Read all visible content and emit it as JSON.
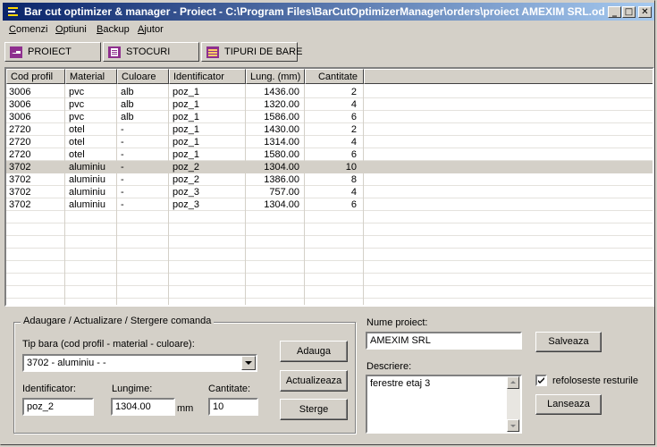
{
  "window": {
    "title": "Bar cut optimizer & manager - Proiect - C:\\Program Files\\BarCutOptimizerManager\\orders\\proiect AMEXIM SRL.odr",
    "minimize_glyph": "_",
    "maximize_glyph": "□",
    "close_glyph": "✕"
  },
  "menu": [
    "Comenzi",
    "Optiuni",
    "Backup",
    "Ajutor"
  ],
  "tabs": [
    {
      "label": "PROIECT",
      "icon": "hand-pointer-icon",
      "color": "#8e2f8e"
    },
    {
      "label": "STOCURI",
      "icon": "document-list-icon",
      "color": "#8e2f8e"
    },
    {
      "label": "TIPURI DE BARE",
      "icon": "bars-stack-icon",
      "color": "#8e2f8e"
    }
  ],
  "table": {
    "columns": [
      "Cod profil",
      "Material",
      "Culoare",
      "Identificator",
      "Lung. (mm)",
      "Cantitate"
    ],
    "rows": [
      [
        "3006",
        "pvc",
        "alb",
        "poz_1",
        "1436.00",
        "2"
      ],
      [
        "3006",
        "pvc",
        "alb",
        "poz_1",
        "1320.00",
        "4"
      ],
      [
        "3006",
        "pvc",
        "alb",
        "poz_1",
        "1586.00",
        "6"
      ],
      [
        "2720",
        "otel",
        "-",
        "poz_1",
        "1430.00",
        "2"
      ],
      [
        "2720",
        "otel",
        "-",
        "poz_1",
        "1314.00",
        "4"
      ],
      [
        "2720",
        "otel",
        "-",
        "poz_1",
        "1580.00",
        "6"
      ],
      [
        "3702",
        "aluminiu",
        "-",
        "poz_2",
        "1304.00",
        "10"
      ],
      [
        "3702",
        "aluminiu",
        "-",
        "poz_2",
        "1386.00",
        "8"
      ],
      [
        "3702",
        "aluminiu",
        "-",
        "poz_3",
        "757.00",
        "4"
      ],
      [
        "3702",
        "aluminiu",
        "-",
        "poz_3",
        "1304.00",
        "6"
      ]
    ],
    "selected_row": 6
  },
  "order_panel": {
    "group_title": "Adaugare / Actualizare / Stergere comanda",
    "bar_type_label": "Tip bara (cod profil - material - culoare):",
    "bar_type_value": "3702 - aluminiu - -",
    "identifier_label": "Identificator:",
    "identifier_value": "poz_2",
    "length_label": "Lungime:",
    "length_value": "1304.00",
    "length_unit": "mm",
    "quantity_label": "Cantitate:",
    "quantity_value": "10",
    "add_button": "Adauga",
    "update_button": "Actualizeaza",
    "delete_button": "Sterge"
  },
  "project_panel": {
    "name_label": "Nume proiect:",
    "name_value": "AMEXIM SRL",
    "save_button": "Salveaza",
    "description_label": "Descriere:",
    "description_value": "ferestre etaj 3",
    "reuse_label": "refoloseste resturile",
    "reuse_checked": true,
    "launch_button": "Lanseaza"
  }
}
